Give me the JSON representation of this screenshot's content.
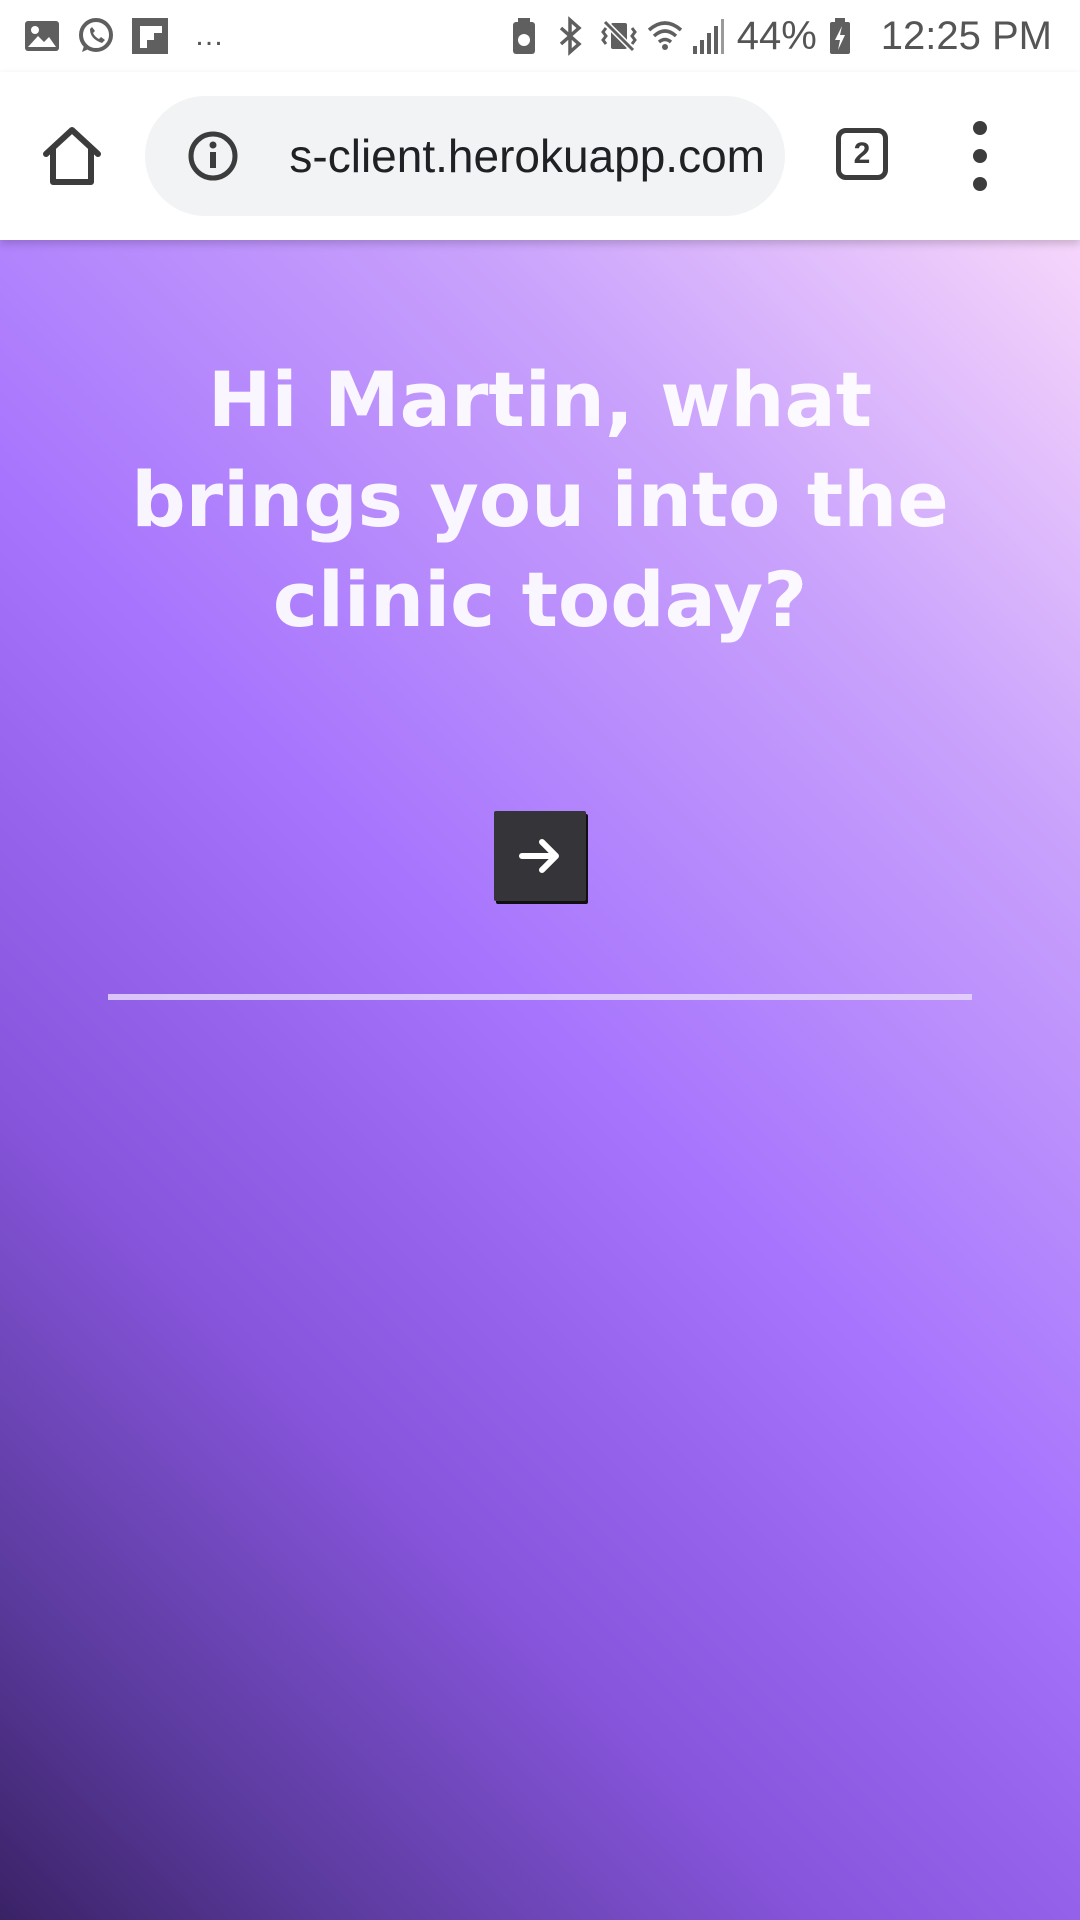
{
  "status_bar": {
    "left_icons": [
      "gallery-icon",
      "whatsapp-icon",
      "flipboard-icon"
    ],
    "more": "…",
    "right_icons": [
      "battery-saver-icon",
      "bluetooth-icon",
      "vibrate-mute-icon",
      "wifi-icon",
      "signal-icon"
    ],
    "battery_percent": "44%",
    "time": "12:25 PM"
  },
  "browser": {
    "url": "s-client.herokuapp.com",
    "tab_count": "2",
    "icons": {
      "home": "home-icon",
      "info": "info-icon",
      "menu": "more-vert-icon"
    }
  },
  "page": {
    "question": "Hi Martin, what brings you into the clinic today?",
    "answer_value": "",
    "next_icon": "arrow-right-icon",
    "colors": {
      "gradient_top_right": "#f6d6fb",
      "gradient_mid": "#a674fd",
      "gradient_bottom_left": "#3a2266",
      "button_bg": "#353539"
    }
  }
}
